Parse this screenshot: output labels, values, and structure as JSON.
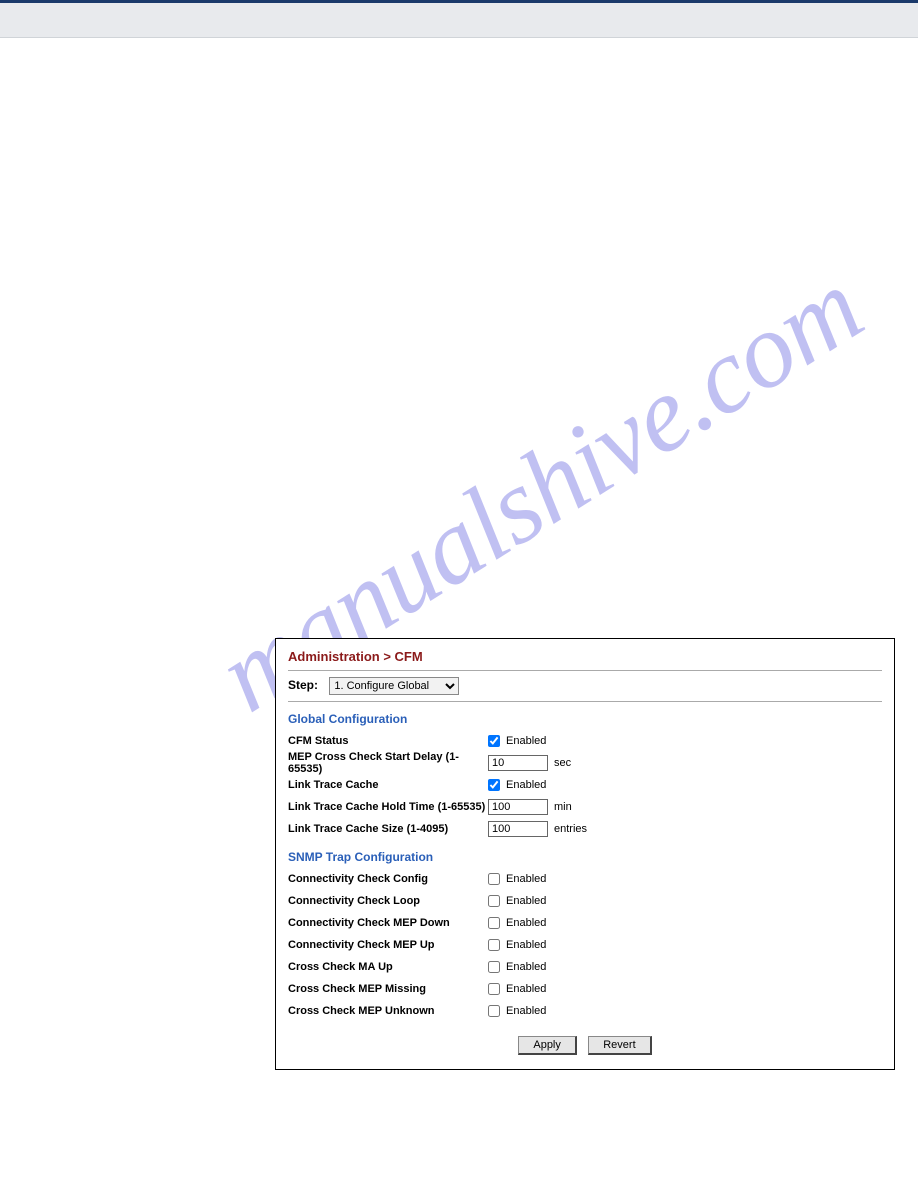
{
  "watermark": "manualshive.com",
  "panel": {
    "title": "Administration > CFM",
    "step_label": "Step:",
    "step_value": "1. Configure Global",
    "sections": {
      "global": {
        "header": "Global Configuration",
        "cfm_status": {
          "label": "CFM Status",
          "checked": true,
          "text": "Enabled"
        },
        "mep_delay": {
          "label": "MEP Cross Check Start Delay (1-65535)",
          "value": "10",
          "unit": "sec"
        },
        "lt_cache": {
          "label": "Link Trace Cache",
          "checked": true,
          "text": "Enabled"
        },
        "lt_hold": {
          "label": "Link Trace Cache Hold Time (1-65535)",
          "value": "100",
          "unit": "min"
        },
        "lt_size": {
          "label": "Link Trace Cache Size (1-4095)",
          "value": "100",
          "unit": "entries"
        }
      },
      "snmp": {
        "header": "SNMP Trap Configuration",
        "cc_config": {
          "label": "Connectivity Check Config",
          "checked": false,
          "text": "Enabled"
        },
        "cc_loop": {
          "label": "Connectivity Check Loop",
          "checked": false,
          "text": "Enabled"
        },
        "cc_mep_down": {
          "label": "Connectivity Check MEP Down",
          "checked": false,
          "text": "Enabled"
        },
        "cc_mep_up": {
          "label": "Connectivity Check MEP Up",
          "checked": false,
          "text": "Enabled"
        },
        "xc_ma_up": {
          "label": "Cross Check MA Up",
          "checked": false,
          "text": "Enabled"
        },
        "xc_mep_miss": {
          "label": "Cross Check MEP Missing",
          "checked": false,
          "text": "Enabled"
        },
        "xc_mep_unk": {
          "label": "Cross Check MEP Unknown",
          "checked": false,
          "text": "Enabled"
        }
      }
    },
    "buttons": {
      "apply": "Apply",
      "revert": "Revert"
    }
  }
}
